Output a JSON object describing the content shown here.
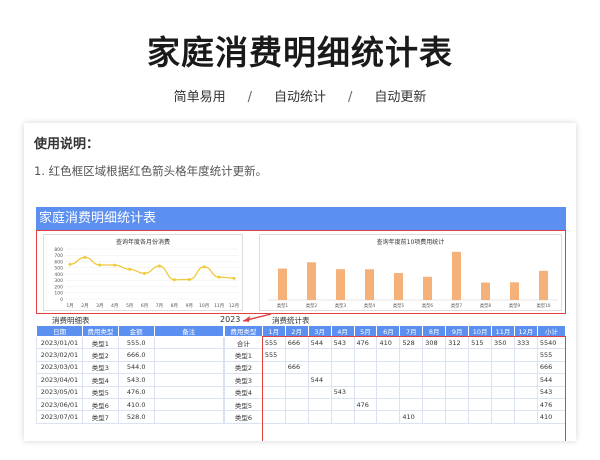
{
  "title": "家庭消费明细统计表",
  "subtitle": [
    "简单易用",
    "/",
    "自动统计",
    "/",
    "自动更新"
  ],
  "usage": {
    "heading": "使用说明：",
    "line1": "1. 红色框区域根据红色箭头格年度统计更新。"
  },
  "sheet": {
    "header": "家庭消费明细统计表",
    "detail_label": "消费明细表",
    "stats_label": "消费统计表",
    "year": "2023",
    "detail_columns": [
      "日期",
      "费用类型",
      "金额",
      "备注"
    ],
    "detail_rows": [
      [
        "2023/01/01",
        "类型1",
        "555.0",
        ""
      ],
      [
        "2023/02/01",
        "类型2",
        "666.0",
        ""
      ],
      [
        "2023/03/01",
        "类型3",
        "544.0",
        ""
      ],
      [
        "2023/04/01",
        "类型4",
        "543.0",
        ""
      ],
      [
        "2023/05/01",
        "类型5",
        "476.0",
        ""
      ],
      [
        "2023/06/01",
        "类型6",
        "410.0",
        ""
      ],
      [
        "2023/07/01",
        "类型7",
        "528.0",
        ""
      ]
    ],
    "stats_columns": [
      "费用类型",
      "1月",
      "2月",
      "3月",
      "4月",
      "5月",
      "6月",
      "7月",
      "8月",
      "9月",
      "10月",
      "11月",
      "12月",
      "小计"
    ],
    "stats_rows": [
      [
        "合计",
        "555",
        "666",
        "544",
        "543",
        "476",
        "410",
        "528",
        "308",
        "312",
        "515",
        "350",
        "333",
        "5540"
      ],
      [
        "类型1",
        "555",
        "",
        "",
        "",
        "",
        "",
        "",
        "",
        "",
        "",
        "",
        "",
        "555"
      ],
      [
        "类型2",
        "",
        "666",
        "",
        "",
        "",
        "",
        "",
        "",
        "",
        "",
        "",
        "",
        "666"
      ],
      [
        "类型3",
        "",
        "",
        "544",
        "",
        "",
        "",
        "",
        "",
        "",
        "",
        "",
        "",
        "544"
      ],
      [
        "类型4",
        "",
        "",
        "",
        "543",
        "",
        "",
        "",
        "",
        "",
        "",
        "",
        "",
        "543"
      ],
      [
        "类型5",
        "",
        "",
        "",
        "",
        "476",
        "",
        "",
        "",
        "",
        "",
        "",
        "",
        "476"
      ],
      [
        "类型6",
        "",
        "",
        "",
        "",
        "",
        "",
        "410",
        "",
        "",
        "",
        "",
        "",
        "410"
      ]
    ]
  },
  "colors": {
    "header_blue": "#5b8ff0",
    "frame_red": "#e04040",
    "line_yellow": "#f0c93a",
    "bar_orange": "#f4b27a"
  },
  "chart_data": [
    {
      "type": "line",
      "title": "查询年度各月份消费",
      "categories": [
        "1月",
        "2月",
        "3月",
        "4月",
        "5月",
        "6月",
        "7月",
        "8月",
        "9月",
        "10月",
        "11月",
        "12月"
      ],
      "values": [
        555,
        666,
        544,
        543,
        476,
        410,
        528,
        308,
        312,
        515,
        350,
        333
      ],
      "y_ticks": [
        "0",
        "100",
        "200",
        "300",
        "400",
        "500",
        "600",
        "700",
        "800"
      ],
      "ylim": [
        0,
        800
      ]
    },
    {
      "type": "bar",
      "title": "查询年度前10项费用统计",
      "categories": [
        "类型1",
        "类型2",
        "类型3",
        "类型4",
        "类型5",
        "类型6",
        "类型7",
        "类型8",
        "类型9",
        "类型10"
      ],
      "values": [
        555,
        666,
        544,
        543,
        476,
        410,
        850,
        308,
        312,
        515
      ],
      "ylim": [
        0,
        900
      ]
    }
  ]
}
